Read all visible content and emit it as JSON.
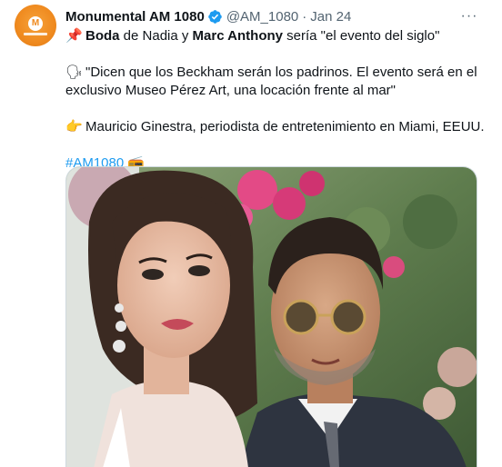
{
  "author": {
    "name": "Monumental AM 1080",
    "handle": "@AM_1080",
    "separator": "·",
    "date": "Jan 24",
    "avatar_icon": "monumental-logo-icon",
    "verified_color": "#1d9bf0"
  },
  "menu": {
    "more_label": "···",
    "icon": "more-options-icon"
  },
  "tweet": {
    "line1": {
      "emoji": "📌",
      "bold1": "Boda",
      "text1": " de Nadia y ",
      "bold2": "Marc Anthony",
      "text2": " sería \"el evento del siglo\""
    },
    "line2": {
      "emoji": "🗣",
      "text": "\"Dicen que los Beckham serán los padrinos. El evento será en el"
    },
    "line3": {
      "text": "exclusivo Museo Pérez Art, una locación frente al mar\""
    },
    "line4": {
      "emoji": "👉",
      "text": "Mauricio Ginestra, periodista de entretenimiento en Miami, EEUU."
    },
    "hashtag": "#AM1080",
    "hashtag_emoji": "📻"
  },
  "colors": {
    "link": "#1d9bf0",
    "secondary": "#536471",
    "brand": "#ef8a1f"
  }
}
